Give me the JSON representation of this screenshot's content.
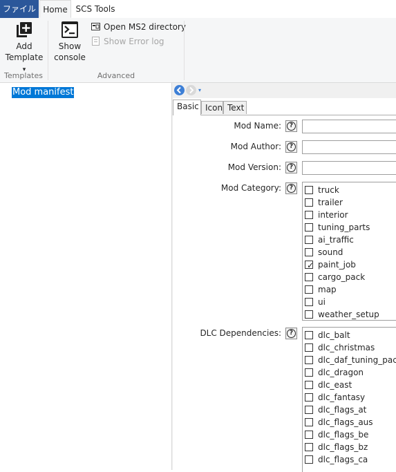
{
  "ribbon": {
    "tabs": [
      "ファイル",
      "Home",
      "SCS Tools"
    ],
    "groups": {
      "templates": {
        "label": "Templates",
        "add_template": {
          "line1": "Add",
          "line2": "Template",
          "dropdown": "▾",
          "icon": "add-template-icon"
        }
      },
      "advanced": {
        "label": "Advanced",
        "show_console": {
          "line1": "Show",
          "line2": "console",
          "icon": "console-icon"
        },
        "open_ms2": {
          "label": "Open MS2 directory",
          "icon": "folder-icon"
        },
        "show_error_log": {
          "label": "Show Error log",
          "icon": "log-icon"
        }
      }
    }
  },
  "tree": {
    "items": [
      "Mod manifest"
    ]
  },
  "property_panel": {
    "tabs": [
      "Basic",
      "Icon",
      "Text"
    ],
    "active_tab": "Basic",
    "fields": {
      "mod_name": {
        "label": "Mod Name:",
        "value": ""
      },
      "mod_author": {
        "label": "Mod Author:",
        "value": ""
      },
      "mod_version": {
        "label": "Mod Version:",
        "value": ""
      },
      "mod_category": {
        "label": "Mod Category:",
        "options": [
          {
            "label": "truck",
            "checked": false
          },
          {
            "label": "trailer",
            "checked": false
          },
          {
            "label": "interior",
            "checked": false
          },
          {
            "label": "tuning_parts",
            "checked": false
          },
          {
            "label": "ai_traffic",
            "checked": false
          },
          {
            "label": "sound",
            "checked": false
          },
          {
            "label": "paint_job",
            "checked": true
          },
          {
            "label": "cargo_pack",
            "checked": false
          },
          {
            "label": "map",
            "checked": false
          },
          {
            "label": "ui",
            "checked": false
          },
          {
            "label": "weather_setup",
            "checked": false
          }
        ]
      },
      "dlc_dependencies": {
        "label": "DLC Dependencies:",
        "options": [
          {
            "label": "dlc_balt",
            "checked": false
          },
          {
            "label": "dlc_christmas",
            "checked": false
          },
          {
            "label": "dlc_daf_tuning_pack",
            "checked": false
          },
          {
            "label": "dlc_dragon",
            "checked": false
          },
          {
            "label": "dlc_east",
            "checked": false
          },
          {
            "label": "dlc_fantasy",
            "checked": false
          },
          {
            "label": "dlc_flags_at",
            "checked": false
          },
          {
            "label": "dlc_flags_aus",
            "checked": false
          },
          {
            "label": "dlc_flags_be",
            "checked": false
          },
          {
            "label": "dlc_flags_bz",
            "checked": false
          },
          {
            "label": "dlc_flags_ca",
            "checked": false
          }
        ]
      }
    },
    "help_glyph": "?",
    "check_glyph": "✓"
  },
  "colors": {
    "file_tab": "#2b579a",
    "selection": "#0078d7",
    "ribbon_bg": "#f5f6f7"
  }
}
